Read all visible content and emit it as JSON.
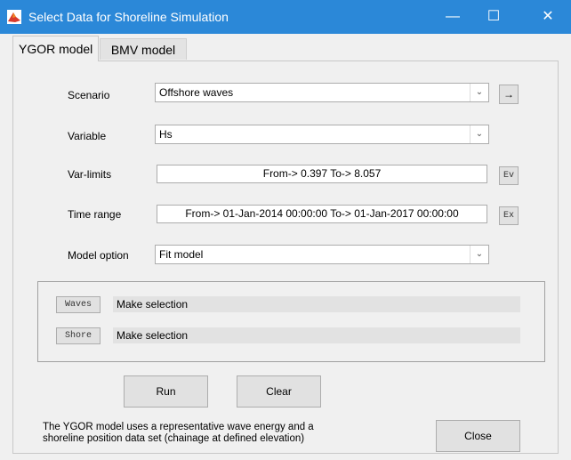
{
  "window": {
    "title": "Select Data for Shoreline Simulation",
    "controls": {
      "minimize": "—",
      "maximize": "☐",
      "close": "✕"
    }
  },
  "tabs": [
    {
      "label": "YGOR model",
      "active": true
    },
    {
      "label": "BMV model",
      "active": false
    }
  ],
  "form": {
    "scenario": {
      "label": "Scenario",
      "value": "Offshore waves",
      "go_button": "→"
    },
    "variable": {
      "label": "Variable",
      "value": "Hs"
    },
    "var_limits": {
      "label": "Var-limits",
      "value": "From-> 0.397  To-> 8.057",
      "button": "Ev"
    },
    "time_range": {
      "label": "Time range",
      "value": "From-> 01-Jan-2014 00:00:00  To-> 01-Jan-2017 00:00:00",
      "button": "Ex"
    },
    "model_option": {
      "label": "Model option",
      "value": "Fit model"
    }
  },
  "selection": {
    "waves": {
      "button": "Waves",
      "status": "Make selection"
    },
    "shore": {
      "button": "Shore",
      "status": "Make selection"
    }
  },
  "actions": {
    "run": "Run",
    "clear": "Clear",
    "close": "Close"
  },
  "info_text": "The YGOR model uses a representative wave energy and a shoreline position data set (chainage at defined elevation)",
  "colors": {
    "titlebar": "#2b88d8",
    "app_icon": "#d93a2b"
  }
}
